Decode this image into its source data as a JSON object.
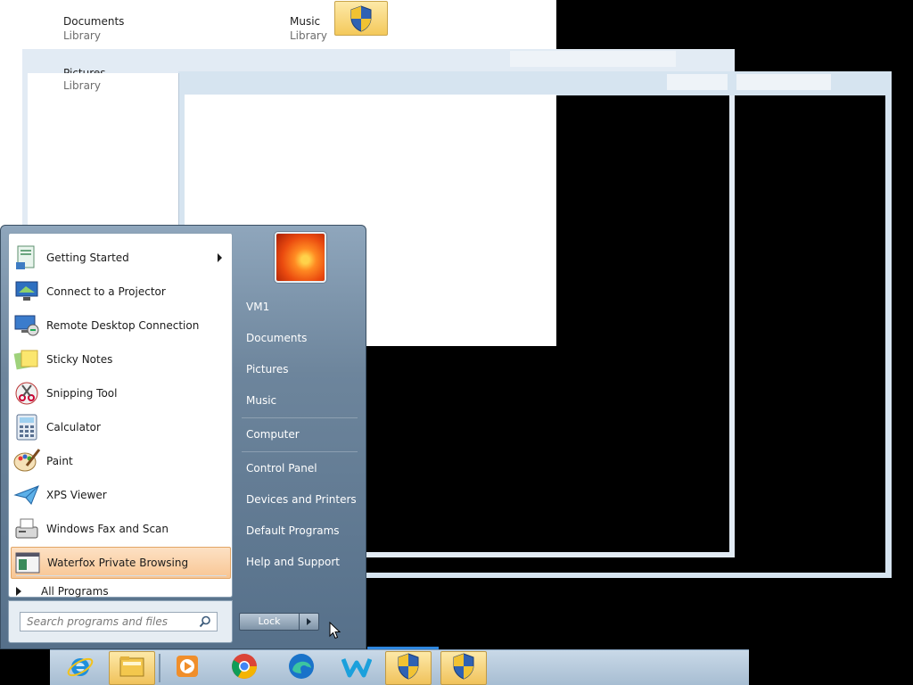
{
  "library": {
    "items": [
      {
        "name": "Documents",
        "sub": "Library"
      },
      {
        "name": "Music",
        "sub": "Library"
      },
      {
        "name": "Pictures",
        "sub": "Library"
      }
    ]
  },
  "start_menu": {
    "programs": [
      {
        "label": "Getting Started",
        "icon": "getting-started-icon",
        "has_submenu": true
      },
      {
        "label": "Connect to a Projector",
        "icon": "projector-icon"
      },
      {
        "label": "Remote Desktop Connection",
        "icon": "remote-desktop-icon"
      },
      {
        "label": "Sticky Notes",
        "icon": "sticky-notes-icon"
      },
      {
        "label": "Snipping Tool",
        "icon": "snipping-tool-icon"
      },
      {
        "label": "Calculator",
        "icon": "calculator-icon"
      },
      {
        "label": "Paint",
        "icon": "paint-icon"
      },
      {
        "label": "XPS Viewer",
        "icon": "xps-viewer-icon"
      },
      {
        "label": "Windows Fax and Scan",
        "icon": "fax-scan-icon"
      },
      {
        "label": "Waterfox Private Browsing",
        "icon": "waterfox-private-icon",
        "highlighted": true
      }
    ],
    "all_programs": "All Programs",
    "search_placeholder": "Search programs and files",
    "right": {
      "user": "VM1",
      "documents": "Documents",
      "pictures": "Pictures",
      "music": "Music",
      "computer": "Computer",
      "control_panel": "Control Panel",
      "devices": "Devices and Printers",
      "default_programs": "Default Programs",
      "help": "Help and Support"
    },
    "lock_label": "Lock"
  },
  "taskbar": {
    "items": [
      {
        "icon": "internet-explorer-icon"
      },
      {
        "icon": "file-explorer-icon",
        "active": true
      },
      {
        "icon": "media-player-icon"
      },
      {
        "icon": "chrome-icon"
      },
      {
        "icon": "edge-icon"
      },
      {
        "icon": "waterfox-icon"
      },
      {
        "icon": "uac-shield-icon",
        "active": true
      },
      {
        "icon": "uac-shield-icon",
        "active": true
      }
    ]
  },
  "colors": {
    "highlight": "#f8c694",
    "start_gradient_top": "#8fa6bc",
    "start_gradient_bottom": "#56708a",
    "taskbar_accent": "#2e86de"
  }
}
